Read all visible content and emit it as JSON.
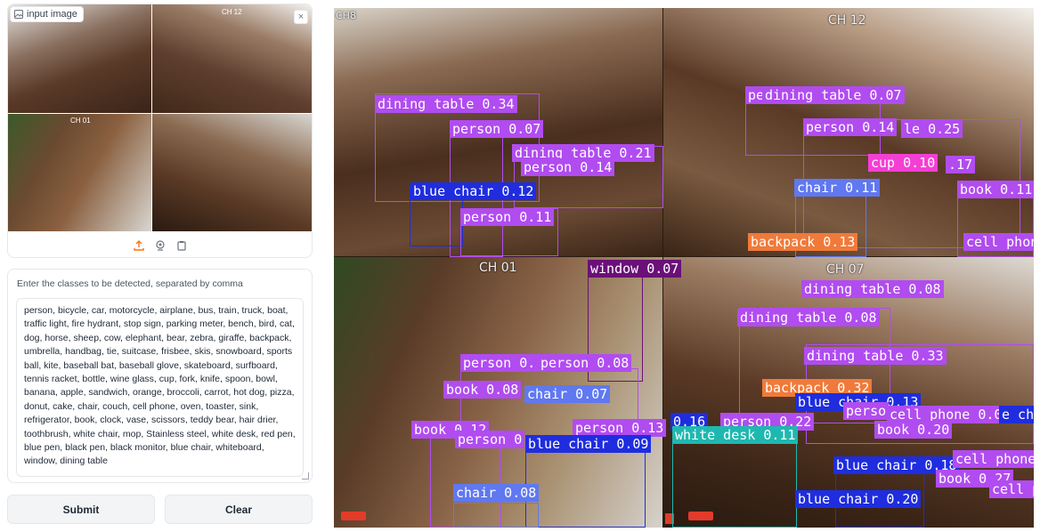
{
  "input_panel": {
    "label": "input image",
    "close": "×",
    "thumbnail_channels": [
      "CH 12",
      "CH 01"
    ],
    "tools": [
      "upload-icon",
      "webcam-icon",
      "clipboard-icon"
    ]
  },
  "classes_panel": {
    "label": "Enter the classes to be detected, separated by comma",
    "value": "person, bicycle, car, motorcycle, airplane, bus, train, truck, boat, traffic light, fire hydrant, stop sign, parking meter, bench, bird, cat, dog, horse, sheep, cow, elephant, bear, zebra, giraffe, backpack, umbrella, handbag, tie, suitcase, frisbee, skis, snowboard, sports ball, kite, baseball bat, baseball glove, skateboard, surfboard, tennis racket, bottle, wine glass, cup, fork, knife, spoon, bowl, banana, apple, sandwich, orange, broccoli, carrot, hot dog, pizza, donut, cake, chair, couch, cell phone, oven, toaster, sink, refrigerator, book, clock, vase, scissors, teddy bear, hair drier, toothbrush, white chair, mop, Stainless steel, white desk, red pen, blue pen, black pen, black monitor, blue chair, whiteboard, window, dining table"
  },
  "buttons": {
    "submit": "Submit",
    "clear": "Clear"
  },
  "output": {
    "channels": [
      {
        "label": "CH8"
      },
      {
        "label": "CH 12"
      },
      {
        "label": "CH 01"
      },
      {
        "label": "CH 07"
      }
    ],
    "detections": [
      {
        "text": "dining table 0.34",
        "color": "#b14cf0"
      },
      {
        "text": "person 0.07",
        "color": "#b14cf0"
      },
      {
        "text": "dining table 0.21",
        "color": "#b14cf0"
      },
      {
        "text": "person 0.14",
        "color": "#b14cf0"
      },
      {
        "text": "blue chair 0.12",
        "color": "#1f2ddf"
      },
      {
        "text": "person 0.11",
        "color": "#b14cf0"
      },
      {
        "text": "pe",
        "color": "#b14cf0"
      },
      {
        "text": "dining table 0.07",
        "color": "#b14cf0"
      },
      {
        "text": "person 0.14",
        "color": "#b14cf0"
      },
      {
        "text": "le 0.25",
        "color": "#b14cf0"
      },
      {
        "text": "cup 0.10",
        "color": "#f43fd4"
      },
      {
        "text": ".17",
        "color": "#b14cf0"
      },
      {
        "text": "chair 0.11",
        "color": "#6078f0"
      },
      {
        "text": "book 0.11",
        "color": "#b14cf0"
      },
      {
        "text": "backpack 0.13",
        "color": "#f07a3a"
      },
      {
        "text": "cell phon",
        "color": "#b14cf0"
      },
      {
        "text": "window 0.07",
        "color": "#6a1078"
      },
      {
        "text": "dining table 0.08",
        "color": "#b14cf0"
      },
      {
        "text": "dining table 0.08",
        "color": "#b14cf0"
      },
      {
        "text": "dining table 0.33",
        "color": "#b14cf0"
      },
      {
        "text": "person 0.",
        "color": "#b14cf0"
      },
      {
        "text": "person 0.08",
        "color": "#b14cf0"
      },
      {
        "text": "backpack 0.32",
        "color": "#f07a3a"
      },
      {
        "text": "book 0.08",
        "color": "#b14cf0"
      },
      {
        "text": "chair 0.07",
        "color": "#6078f0"
      },
      {
        "text": "blue chair 0.13",
        "color": "#1f2ddf"
      },
      {
        "text": "perso",
        "color": "#b14cf0"
      },
      {
        "text": "cell phone 0.09",
        "color": "#b14cf0"
      },
      {
        "text": "e ch",
        "color": "#1f2ddf"
      },
      {
        "text": "0.16",
        "color": "#1f2ddf"
      },
      {
        "text": "person 0.22",
        "color": "#b14cf0"
      },
      {
        "text": "book 0.12",
        "color": "#b14cf0"
      },
      {
        "text": "person 0",
        "color": "#b14cf0"
      },
      {
        "text": "person 0.13",
        "color": "#b14cf0"
      },
      {
        "text": "blue chair 0.09",
        "color": "#1f2ddf"
      },
      {
        "text": "white desk 0.11",
        "color": "#1fb8b0"
      },
      {
        "text": "book 0.20",
        "color": "#b14cf0"
      },
      {
        "text": "blue chair 0.18",
        "color": "#1f2ddf"
      },
      {
        "text": "cell phone",
        "color": "#b14cf0"
      },
      {
        "text": "book 0.27",
        "color": "#b14cf0"
      },
      {
        "text": "cell p",
        "color": "#b14cf0"
      },
      {
        "text": "chair 0.08",
        "color": "#6078f0"
      },
      {
        "text": "blue chair 0.20",
        "color": "#1f2ddf"
      }
    ]
  }
}
